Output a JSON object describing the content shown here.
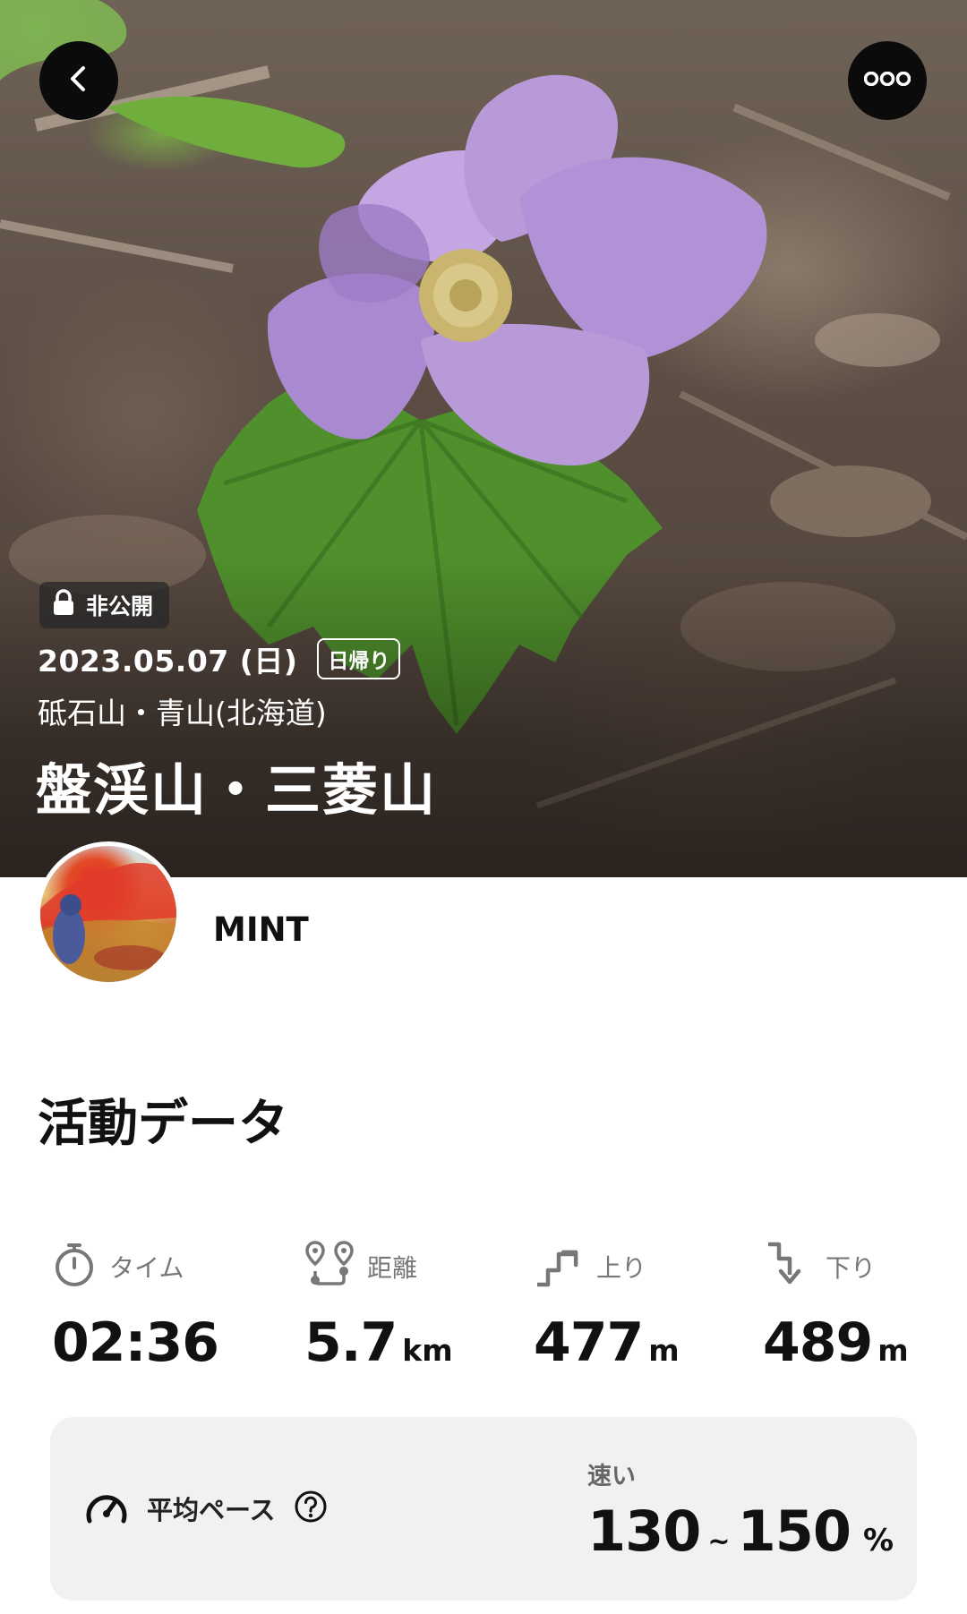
{
  "header": {
    "back_icon": "chevron-left-icon",
    "more_icon": "ellipsis-icon"
  },
  "record": {
    "privacy_label": "非公開",
    "privacy_icon": "lock-icon",
    "date": "2023.05.07 (日)",
    "trip_type": "日帰り",
    "area": "砥石山・青山(北海道)",
    "title": "盤渓山・三菱山"
  },
  "user": {
    "name": "MINT"
  },
  "activity": {
    "section_title": "活動データ",
    "stats": [
      {
        "label": "タイム",
        "icon": "stopwatch-icon",
        "value": "02:36",
        "unit": ""
      },
      {
        "label": "距離",
        "icon": "route-icon",
        "value": "5.7",
        "unit": "km"
      },
      {
        "label": "上り",
        "icon": "ascent-arrow-icon",
        "value": "477",
        "unit": "m"
      },
      {
        "label": "下り",
        "icon": "descent-arrow-icon",
        "value": "489",
        "unit": "m"
      }
    ],
    "pace": {
      "label": "平均ペース",
      "help_icon": "help-circle-icon",
      "caption": "速い",
      "min": "130",
      "separator": "~",
      "max": "150",
      "unit": "%"
    }
  },
  "colors": {
    "card_bg": "#f1f1f1",
    "button_bg": "#0b0b0b",
    "flower": "#b99ad8",
    "leaf": "#4f8f2c"
  }
}
